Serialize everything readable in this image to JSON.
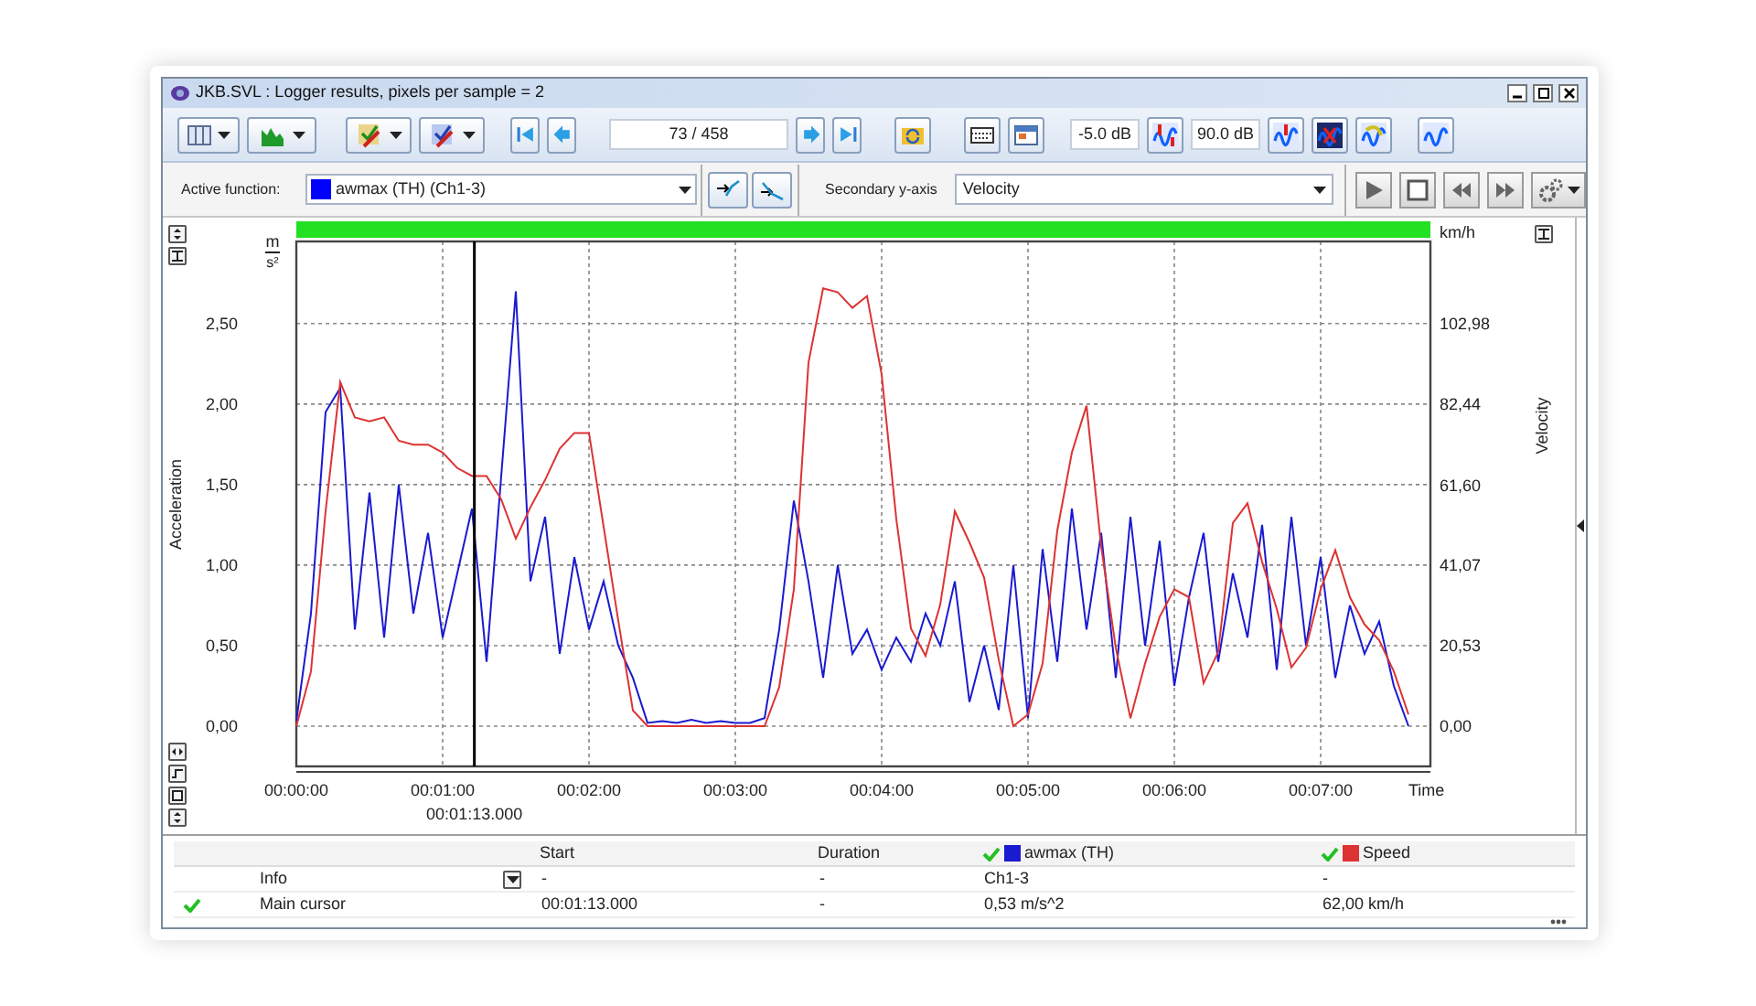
{
  "window": {
    "title": "JKB.SVL : Logger results, pixels per sample = 2"
  },
  "toolbar": {
    "position": "73 / 458",
    "low_level": "-5.0 dB",
    "high_level": "90.0 dB"
  },
  "function_bar": {
    "active_label": "Active function:",
    "active_function": {
      "text": "awmax (TH) (Ch1-3)",
      "color": "#0000ff"
    },
    "secondary_label": "Secondary y-axis",
    "secondary_axis": "Velocity"
  },
  "chart": {
    "cursor_time": "00:01:13.000",
    "y_unit": {
      "top": "m",
      "bottom": "s²"
    },
    "y2_unit": "km/h",
    "chart_data": {
      "type": "line",
      "xlabel": "Time",
      "ylabel": "Acceleration",
      "y2label": "Velocity",
      "xlim": [
        0,
        465
      ],
      "ylim": [
        -0.25,
        3.01
      ],
      "y2lim": [
        -10.3,
        124.0
      ],
      "y2ticks": [
        {
          "value": 0,
          "label": "0,00"
        },
        {
          "value": 20.53,
          "label": "20,53"
        },
        {
          "value": 41.07,
          "label": "41,07"
        },
        {
          "value": 61.6,
          "label": "61,60"
        },
        {
          "value": 82.44,
          "label": "82,44"
        },
        {
          "value": 102.98,
          "label": "102,98"
        }
      ],
      "xticks": [
        {
          "value": 0,
          "label": "00:00:00"
        },
        {
          "value": 60,
          "label": "00:01:00"
        },
        {
          "value": 120,
          "label": "00:02:00"
        },
        {
          "value": 180,
          "label": "00:03:00"
        },
        {
          "value": 240,
          "label": "00:04:00"
        },
        {
          "value": 300,
          "label": "00:05:00"
        },
        {
          "value": 360,
          "label": "00:06:00"
        },
        {
          "value": 420,
          "label": "00:07:00"
        }
      ],
      "yticks": [
        {
          "value": 0,
          "label": "0,00"
        },
        {
          "value": 0.5,
          "label": "0,50"
        },
        {
          "value": 1,
          "label": "1,00"
        },
        {
          "value": 1.5,
          "label": "1,50"
        },
        {
          "value": 2,
          "label": "2,00"
        },
        {
          "value": 2.5,
          "label": "2,50"
        }
      ],
      "x": [
        0,
        6,
        12,
        18,
        24,
        30,
        36,
        42,
        48,
        54,
        60,
        66,
        72,
        78,
        84,
        90,
        96,
        102,
        108,
        114,
        120,
        126,
        132,
        138,
        144,
        150,
        156,
        162,
        168,
        174,
        180,
        186,
        192,
        198,
        204,
        210,
        216,
        222,
        228,
        234,
        240,
        246,
        252,
        258,
        264,
        270,
        276,
        282,
        288,
        294,
        300,
        306,
        312,
        318,
        324,
        330,
        336,
        342,
        348,
        354,
        360,
        366,
        372,
        378,
        384,
        390,
        396,
        402,
        408,
        414,
        420,
        426,
        432,
        438,
        444,
        450,
        456
      ],
      "series": [
        {
          "name": "awmax (TH)",
          "color": "#1a1ad0",
          "values": [
            0.03,
            0.7,
            1.95,
            2.1,
            0.6,
            1.45,
            0.55,
            1.5,
            0.7,
            1.2,
            0.55,
            0.95,
            1.35,
            0.4,
            1.55,
            2.7,
            0.9,
            1.3,
            0.45,
            1.05,
            0.6,
            0.9,
            0.5,
            0.3,
            0.02,
            0.03,
            0.02,
            0.04,
            0.02,
            0.03,
            0.02,
            0.02,
            0.05,
            0.6,
            1.4,
            0.9,
            0.3,
            1.0,
            0.45,
            0.6,
            0.35,
            0.55,
            0.4,
            0.7,
            0.5,
            0.9,
            0.15,
            0.5,
            0.1,
            1.0,
            0.05,
            1.1,
            0.4,
            1.35,
            0.6,
            1.2,
            0.3,
            1.3,
            0.5,
            1.15,
            0.25,
            0.8,
            1.2,
            0.4,
            0.95,
            0.55,
            1.25,
            0.35,
            1.3,
            0.5,
            1.05,
            0.3,
            0.75,
            0.45,
            0.65,
            0.25,
            0.0
          ]
        },
        {
          "name": "Speed",
          "color": "#dd3333",
          "axis": "y2",
          "values": [
            0,
            14,
            55,
            88,
            79,
            78,
            79,
            73,
            72,
            72,
            70,
            66,
            64,
            64,
            58,
            48,
            56,
            63,
            71,
            75,
            75,
            51,
            27,
            4,
            0,
            0,
            0,
            0,
            0,
            0,
            0,
            0,
            0,
            10,
            35,
            93,
            112,
            111,
            107,
            110,
            90,
            53,
            25,
            18,
            31,
            55,
            47,
            38,
            17,
            0,
            3,
            16,
            50,
            70,
            82,
            46,
            20,
            2,
            16,
            28,
            35,
            33,
            11,
            19,
            52,
            57,
            42,
            30,
            15,
            20,
            35,
            45,
            33,
            26,
            22,
            14,
            3
          ]
        }
      ],
      "grid": true,
      "ref_lines": [
        {
          "axis": "x",
          "value": 73
        }
      ]
    }
  },
  "table": {
    "columns": [
      {
        "label": "Start"
      },
      {
        "label": "Duration"
      }
    ],
    "channel_columns": [
      {
        "visible": true
      },
      {
        "visible": true
      }
    ],
    "rows": [
      {
        "label": "Info",
        "kind": "info",
        "checked": false,
        "cells": [
          "-",
          "-",
          "Ch1-3",
          "-"
        ]
      },
      {
        "label": "Main cursor",
        "kind": "cursor",
        "checked": true,
        "cells": [
          "00:01:13.000",
          "-",
          "0,53 m/s^2",
          "62,00 km/h"
        ]
      }
    ]
  }
}
